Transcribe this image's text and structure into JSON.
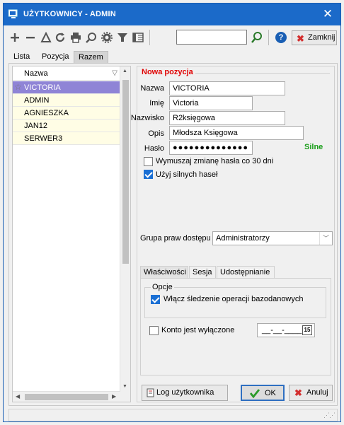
{
  "window": {
    "title": "UŻYTKOWNICY - ADMIN"
  },
  "toolbar": {
    "icons": [
      "add-icon",
      "remove-icon",
      "edit-icon",
      "refresh-icon",
      "print-icon",
      "preview-icon",
      "settings-icon",
      "filter-icon",
      "columns-icon"
    ],
    "search_value": "",
    "help_label": "?",
    "close_label": "Zamknij"
  },
  "top_tabs": [
    "Lista",
    "Pozycja",
    "Razem"
  ],
  "active_top_tab": "Razem",
  "list": {
    "header": "Nazwa",
    "rows": [
      "VICTORIA",
      "ADMIN",
      "AGNIESZKA",
      "JAN12",
      "SERWER3"
    ],
    "selected_index": 0
  },
  "form": {
    "section_title": "Nowa pozycja",
    "fields": {
      "nazwa": {
        "label": "Nazwa",
        "value": "VICTORIA"
      },
      "imie": {
        "label": "Imię",
        "value": "Victoria"
      },
      "nazwisko": {
        "label": "Nazwisko",
        "value": "R2księgowa"
      },
      "opis": {
        "label": "Opis",
        "value": "Młodsza Księgowa"
      },
      "haslo": {
        "label": "Hasło",
        "value": "●●●●●●●●●●●●●●",
        "strength": "Silne"
      }
    },
    "checks": {
      "force_change": {
        "label": "Wymuszaj zmianę hasła co 30 dni",
        "checked": false
      },
      "strong_passwords": {
        "label": "Użyj silnych haseł",
        "checked": true
      }
    },
    "group": {
      "label": "Grupa praw dostępu",
      "value": "Administratorzy"
    }
  },
  "inner_tabs": [
    "Właściwości",
    "Sesja",
    "Udostępnianie"
  ],
  "active_inner_tab": "Właściwości",
  "options": {
    "group_title": "Opcje",
    "audit": {
      "label": "Włącz śledzenie operacji bazodanowych",
      "checked": true
    },
    "disabled": {
      "label": "Konto jest wyłączone",
      "checked": false
    },
    "date_value": "__-__-____",
    "calendar_glyph": "15"
  },
  "buttons": {
    "log_label": "Log użytkownika",
    "ok_label": "OK",
    "cancel_label": "Anuluj"
  },
  "colors": {
    "titlebar": "#1b6ac9",
    "selected_row": "#8f84d6",
    "row_bg": "#fffde5",
    "section_title": "#e00000",
    "strength": "#1a9e1a"
  }
}
